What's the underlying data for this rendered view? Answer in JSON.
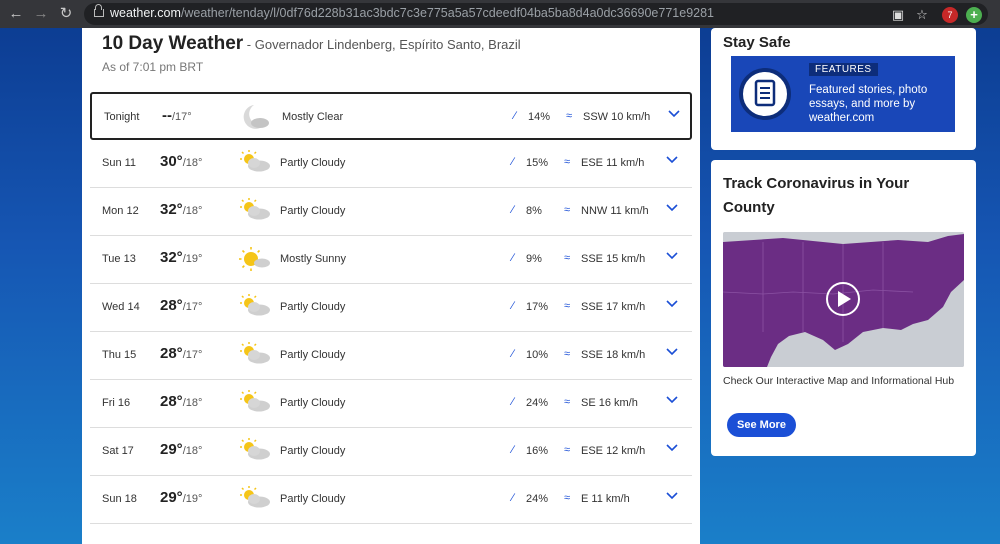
{
  "browser": {
    "url_host": "weather.com",
    "url_path": "/weather/tenday/l/0df76d228b31ac3bdc7c3e775a5a57cdeedf04ba5ba8d4a0dc36690e771e9281",
    "ext_badge": "7"
  },
  "page": {
    "title": "10 Day Weather",
    "location": " - Governador Lindenberg, Espírito Santo, Brazil",
    "as_of": "As of 7:01 pm BRT"
  },
  "forecast": [
    {
      "day": "Tonight",
      "high": "--",
      "low": "/17°",
      "icon": "clear-night-icon",
      "condition": "Mostly Clear",
      "precip": "14%",
      "wind": "SSW 10 km/h"
    },
    {
      "day": "Sun 11",
      "high": "30°",
      "low": "/18°",
      "icon": "partly-cloudy-icon",
      "condition": "Partly Cloudy",
      "precip": "15%",
      "wind": "ESE 11 km/h"
    },
    {
      "day": "Mon 12",
      "high": "32°",
      "low": "/18°",
      "icon": "partly-cloudy-icon",
      "condition": "Partly Cloudy",
      "precip": "8%",
      "wind": "NNW 11 km/h"
    },
    {
      "day": "Tue 13",
      "high": "32°",
      "low": "/19°",
      "icon": "mostly-sunny-icon",
      "condition": "Mostly Sunny",
      "precip": "9%",
      "wind": "SSE 15 km/h"
    },
    {
      "day": "Wed 14",
      "high": "28°",
      "low": "/17°",
      "icon": "partly-cloudy-icon",
      "condition": "Partly Cloudy",
      "precip": "17%",
      "wind": "SSE 17 km/h"
    },
    {
      "day": "Thu 15",
      "high": "28°",
      "low": "/17°",
      "icon": "partly-cloudy-icon",
      "condition": "Partly Cloudy",
      "precip": "10%",
      "wind": "SSE 18 km/h"
    },
    {
      "day": "Fri 16",
      "high": "28°",
      "low": "/18°",
      "icon": "partly-cloudy-icon",
      "condition": "Partly Cloudy",
      "precip": "24%",
      "wind": "SE 16 km/h"
    },
    {
      "day": "Sat 17",
      "high": "29°",
      "low": "/18°",
      "icon": "partly-cloudy-icon",
      "condition": "Partly Cloudy",
      "precip": "16%",
      "wind": "ESE 12 km/h"
    },
    {
      "day": "Sun 18",
      "high": "29°",
      "low": "/19°",
      "icon": "partly-cloudy-icon",
      "condition": "Partly Cloudy",
      "precip": "24%",
      "wind": "E 11 km/h"
    }
  ],
  "sidebar": {
    "stay_safe_title": "Stay Safe",
    "features_tag": "FEATURES",
    "features_text": "Featured stories, photo essays, and more by weather.com",
    "covid_title": "Track Coronavirus in Your County",
    "map_caption": "Check Our Interactive Map and Informational Hub",
    "see_more": "See More"
  },
  "colors": {
    "accent": "#1b4fd6",
    "page_bg": "#1656b3",
    "banner": "#1947b8"
  }
}
